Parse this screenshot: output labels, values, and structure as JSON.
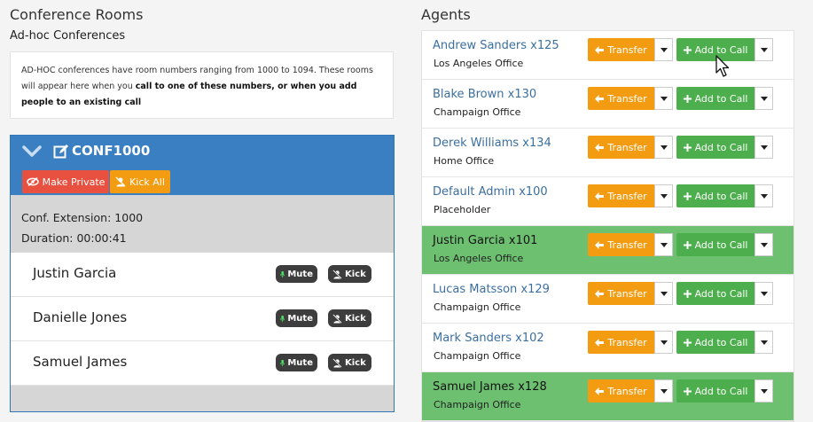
{
  "left": {
    "title": "Conference Rooms",
    "subtitle": "Ad-hoc Conferences",
    "info": {
      "text_start": "AD-HOC conferences have room numbers ranging from 1000 to 1094. These rooms will appear here when you ",
      "text_bold": "call to one of these numbers, or when you add people to an existing call"
    },
    "conference": {
      "name": "CONF1000",
      "make_private_label": "Make Private",
      "kick_all_label": "Kick All",
      "extension": "Conf. Extension: 1000",
      "duration": "Duration: 00:00:41",
      "participants": [
        {
          "name": "Justin Garcia",
          "mute_label": "Mute",
          "kick_label": "Kick"
        },
        {
          "name": "Danielle Jones",
          "mute_label": "Mute",
          "kick_label": "Kick"
        },
        {
          "name": "Samuel James",
          "mute_label": "Mute",
          "kick_label": "Kick"
        }
      ]
    }
  },
  "right": {
    "title": "Agents",
    "transfer_label": "Transfer",
    "add_label": "Add to Call",
    "agents": [
      {
        "name": "Andrew Sanders x125",
        "office": "Los Angeles Office",
        "active": false
      },
      {
        "name": "Blake Brown x130",
        "office": "Champaign Office",
        "active": false
      },
      {
        "name": "Derek Williams x134",
        "office": "Home Office",
        "active": false
      },
      {
        "name": "Default Admin x100",
        "office": "Placeholder",
        "active": false
      },
      {
        "name": "Justin Garcia x101",
        "office": "Los Angeles Office",
        "active": true
      },
      {
        "name": "Lucas Matsson x129",
        "office": "Champaign Office",
        "active": false
      },
      {
        "name": "Mark Sanders x102",
        "office": "Champaign Office",
        "active": false
      },
      {
        "name": "Samuel James x128",
        "office": "Champaign Office",
        "active": true
      }
    ]
  },
  "colors": {
    "primary": "#3a7fc1",
    "danger": "#e8503f",
    "warning": "#f39c12",
    "success": "#4cae4c",
    "active_row": "#6cc070"
  }
}
